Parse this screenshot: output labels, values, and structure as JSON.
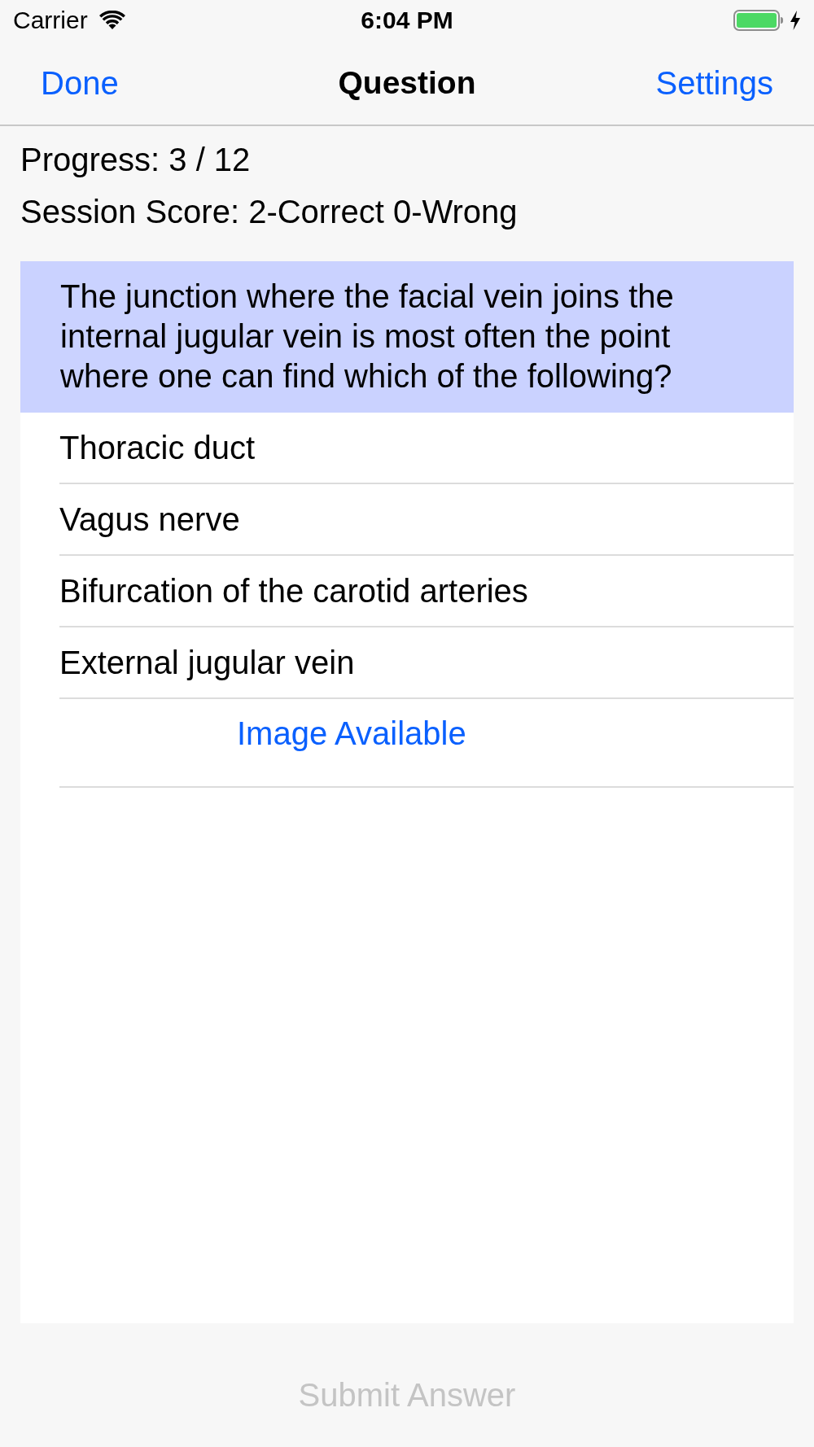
{
  "status_bar": {
    "carrier": "Carrier",
    "time": "6:04 PM"
  },
  "nav_bar": {
    "left_button": "Done",
    "title": "Question",
    "right_button": "Settings"
  },
  "progress": "Progress: 3 / 12",
  "session_score": "Session Score: 2-Correct 0-Wrong",
  "question": "The junction where the facial vein joins the internal jugular vein is most often the point where one can find which of the following?",
  "answers": [
    {
      "text": "Thoracic duct",
      "selected": false
    },
    {
      "text": "Vagus nerve",
      "selected": false
    },
    {
      "text": "Bifurcation of the carotid arteries",
      "selected": false
    },
    {
      "text": "External jugular vein",
      "selected": false
    }
  ],
  "image_link": "Image Available",
  "submit_button": {
    "label": "Submit Answer",
    "disabled": true
  }
}
